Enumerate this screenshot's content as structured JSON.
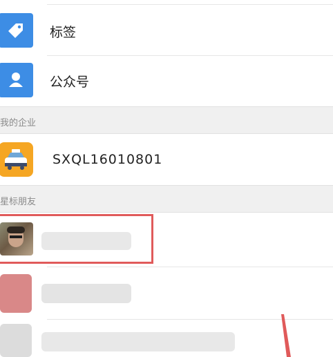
{
  "contacts": {
    "rows": [
      {
        "label": "标签",
        "icon": "tag-icon",
        "icon_color": "#3d8de5"
      },
      {
        "label": "公众号",
        "icon": "user-icon",
        "icon_color": "#3d8de5"
      }
    ]
  },
  "sections": {
    "my_enterprise": "我的企业",
    "starred_friends": "星标朋友"
  },
  "enterprise": {
    "name": "SXQL16010801",
    "icon": "taxi-icon",
    "icon_color": "#f5a623"
  },
  "highlight_color": "#e05a5a"
}
